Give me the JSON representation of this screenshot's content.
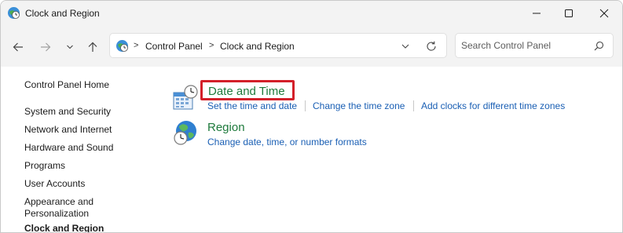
{
  "window": {
    "title": "Clock and Region",
    "icons": {
      "app": "clock-globe-icon",
      "minimize": "minimize-icon",
      "maximize": "maximize-icon",
      "close": "close-icon"
    }
  },
  "nav": {
    "icons": [
      "back-arrow-icon",
      "forward-arrow-icon",
      "chevron-down-icon",
      "up-arrow-icon"
    ],
    "breadcrumb": [
      "Control Panel",
      "Clock and Region"
    ],
    "breadcrumb_separator": ">",
    "search_placeholder": "Search Control Panel",
    "search_value": ""
  },
  "sidebar": {
    "home": "Control Panel Home",
    "items": [
      "System and Security",
      "Network and Internet",
      "Hardware and Sound",
      "Programs",
      "User Accounts",
      "Appearance and Personalization",
      "Clock and Region"
    ]
  },
  "main": {
    "categories": [
      {
        "title": "Date and Time",
        "icon": "calendar-clock-icon",
        "highlighted": true,
        "tasks": [
          "Set the time and date",
          "Change the time zone",
          "Add clocks for different time zones"
        ]
      },
      {
        "title": "Region",
        "icon": "globe-clock-icon",
        "highlighted": false,
        "tasks": [
          "Change date, time, or number formats"
        ]
      }
    ]
  },
  "colors": {
    "category_title": "#1e7a3c",
    "link": "#1a5fb4",
    "highlight_border": "#d3202a",
    "chrome_background": "#f3f3f3"
  }
}
